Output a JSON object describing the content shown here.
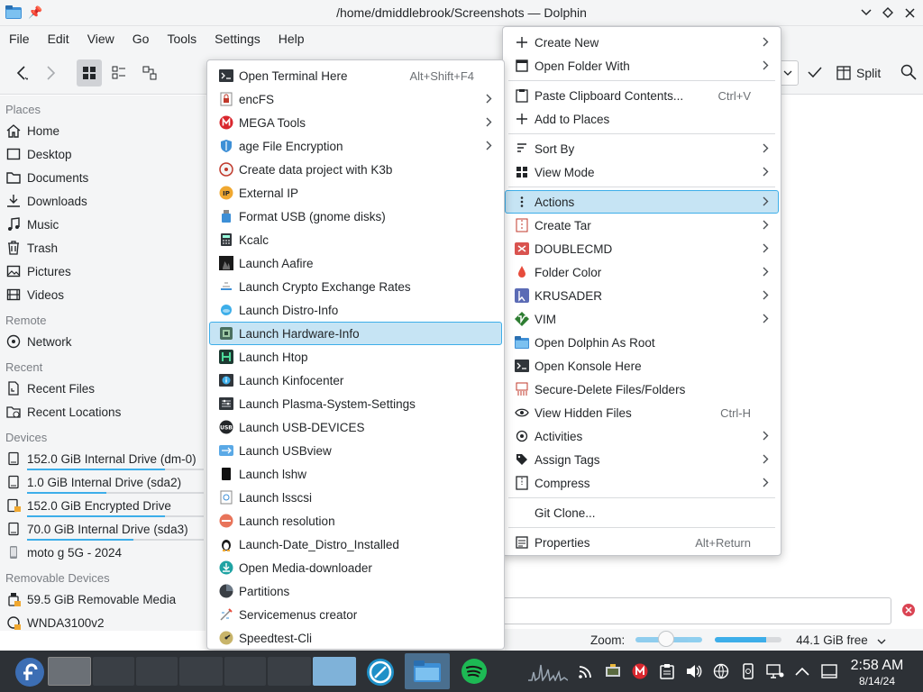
{
  "window": {
    "title": "/home/dmiddlebrook/Screenshots — Dolphin"
  },
  "menubar": [
    "File",
    "Edit",
    "View",
    "Go",
    "Tools",
    "Settings",
    "Help"
  ],
  "toolbar": {
    "split_label": "Split"
  },
  "sidebar": {
    "sections": [
      {
        "title": "Places",
        "items": [
          {
            "label": "Home",
            "icon": "home-icon"
          },
          {
            "label": "Desktop",
            "icon": "desktop-icon"
          },
          {
            "label": "Documents",
            "icon": "documents-icon"
          },
          {
            "label": "Downloads",
            "icon": "downloads-icon"
          },
          {
            "label": "Music",
            "icon": "music-icon"
          },
          {
            "label": "Trash",
            "icon": "trash-icon"
          },
          {
            "label": "Pictures",
            "icon": "pictures-icon"
          },
          {
            "label": "Videos",
            "icon": "videos-icon"
          }
        ]
      },
      {
        "title": "Remote",
        "items": [
          {
            "label": "Network",
            "icon": "network-icon"
          }
        ]
      },
      {
        "title": "Recent",
        "items": [
          {
            "label": "Recent Files",
            "icon": "recent-files-icon"
          },
          {
            "label": "Recent Locations",
            "icon": "recent-locations-icon"
          }
        ]
      },
      {
        "title": "Devices",
        "items": [
          {
            "label": "152.0 GiB Internal Drive (dm-0)",
            "icon": "drive-icon",
            "usage": 0.78
          },
          {
            "label": "1.0 GiB Internal Drive (sda2)",
            "icon": "drive-icon",
            "usage": 0.45
          },
          {
            "label": "152.0 GiB Encrypted Drive",
            "icon": "encrypted-drive-icon",
            "usage": 0.78
          },
          {
            "label": "70.0 GiB Internal Drive (sda3)",
            "icon": "drive-icon",
            "usage": 0.6
          },
          {
            "label": "moto g 5G - 2024",
            "icon": "phone-icon"
          }
        ]
      },
      {
        "title": "Removable Devices",
        "items": [
          {
            "label": "59.5 GiB Removable Media",
            "icon": "removable-media-icon"
          },
          {
            "label": "WNDA3100v2",
            "icon": "usb-device-icon"
          }
        ]
      }
    ]
  },
  "context_menu": {
    "items": [
      {
        "label": "Create New",
        "icon": "plus-icon",
        "submenu": true
      },
      {
        "label": "Open Folder With",
        "icon": "open-with-icon",
        "submenu": true
      },
      {
        "separator": true
      },
      {
        "label": "Paste Clipboard Contents...",
        "icon": "paste-icon",
        "shortcut": "Ctrl+V"
      },
      {
        "label": "Add to Places",
        "icon": "add-places-icon"
      },
      {
        "separator": true
      },
      {
        "label": "Sort By",
        "icon": "sort-icon",
        "submenu": true
      },
      {
        "label": "View Mode",
        "icon": "view-mode-icon",
        "submenu": true
      },
      {
        "separator": true
      },
      {
        "label": "Actions",
        "icon": "actions-icon",
        "submenu": true,
        "highlighted": true
      },
      {
        "label": "Create Tar",
        "icon": "tar-icon",
        "submenu": true
      },
      {
        "label": "DOUBLECMD",
        "icon": "doublecmd-icon",
        "submenu": true
      },
      {
        "label": "Folder Color",
        "icon": "folder-color-icon",
        "submenu": true
      },
      {
        "label": "KRUSADER",
        "icon": "krusader-icon",
        "submenu": true
      },
      {
        "label": "VIM",
        "icon": "vim-icon",
        "submenu": true
      },
      {
        "label": "Open Dolphin As Root",
        "icon": "folder-icon"
      },
      {
        "label": "Open Konsole Here",
        "icon": "konsole-icon"
      },
      {
        "label": "Secure-Delete Files/Folders",
        "icon": "shred-icon"
      },
      {
        "label": "View Hidden Files",
        "icon": "eye-icon",
        "shortcut": "Ctrl-H"
      },
      {
        "label": "Activities",
        "icon": "activities-icon",
        "submenu": true
      },
      {
        "label": "Assign Tags",
        "icon": "tag-icon",
        "submenu": true
      },
      {
        "label": "Compress",
        "icon": "compress-icon",
        "submenu": true
      },
      {
        "separator": true
      },
      {
        "label": "Git Clone...",
        "icon": ""
      },
      {
        "separator": true
      },
      {
        "label": "Properties",
        "icon": "properties-icon",
        "shortcut": "Alt+Return"
      }
    ]
  },
  "actions_submenu": {
    "items": [
      {
        "label": "Open Terminal Here",
        "icon": "terminal-icon",
        "shortcut": "Alt+Shift+F4"
      },
      {
        "label": "encFS",
        "icon": "lock-icon",
        "submenu": true
      },
      {
        "label": "MEGA Tools",
        "icon": "mega-icon",
        "submenu": true
      },
      {
        "label": "age File Encryption",
        "icon": "shield-icon",
        "submenu": true
      },
      {
        "label": "Create data project with K3b",
        "icon": "k3b-icon"
      },
      {
        "label": "External IP",
        "icon": "ip-icon"
      },
      {
        "label": "Format USB (gnome disks)",
        "icon": "usb-drive-icon"
      },
      {
        "label": "Kcalc",
        "icon": "calculator-icon"
      },
      {
        "label": "Launch Aafire",
        "icon": "fire-icon"
      },
      {
        "label": "Launch Crypto Exchange Rates",
        "icon": "crypto-icon"
      },
      {
        "label": "Launch Distro-Info",
        "icon": "distro-icon"
      },
      {
        "label": "Launch Hardware-Info",
        "icon": "hardware-icon",
        "highlighted": true
      },
      {
        "label": "Launch Htop",
        "icon": "htop-icon"
      },
      {
        "label": "Launch Kinfocenter",
        "icon": "info-center-icon"
      },
      {
        "label": "Launch Plasma-System-Settings",
        "icon": "settings-icon"
      },
      {
        "label": "Launch USB-DEVICES",
        "icon": "usb-icon"
      },
      {
        "label": "Launch USBview",
        "icon": "usbview-icon"
      },
      {
        "label": "Launch lshw",
        "icon": "lshw-icon"
      },
      {
        "label": "Launch lsscsi",
        "icon": "lsscsi-icon"
      },
      {
        "label": "Launch resolution",
        "icon": "resolution-icon"
      },
      {
        "label": "Launch-Date_Distro_Installed",
        "icon": "tux-icon"
      },
      {
        "label": "Open Media-downloader",
        "icon": "media-downloader-icon"
      },
      {
        "label": "Partitions",
        "icon": "partitions-icon"
      },
      {
        "label": "Servicemenus creator",
        "icon": "servicemenus-icon"
      },
      {
        "label": "Speedtest-Cli",
        "icon": "speedtest-icon"
      }
    ]
  },
  "statusbar": {
    "zoom_label": "Zoom:",
    "zoom_level": 0.45,
    "free_space": "44.1 GiB free",
    "used_fraction": 0.76
  },
  "taskbar": {
    "time": "2:58 AM",
    "date": "8/14/24"
  },
  "colors": {
    "accent": "#3daee9",
    "highlight": "#c6e4f4",
    "taskbar": "#2d3136",
    "window_bg": "#f4f5f6"
  }
}
